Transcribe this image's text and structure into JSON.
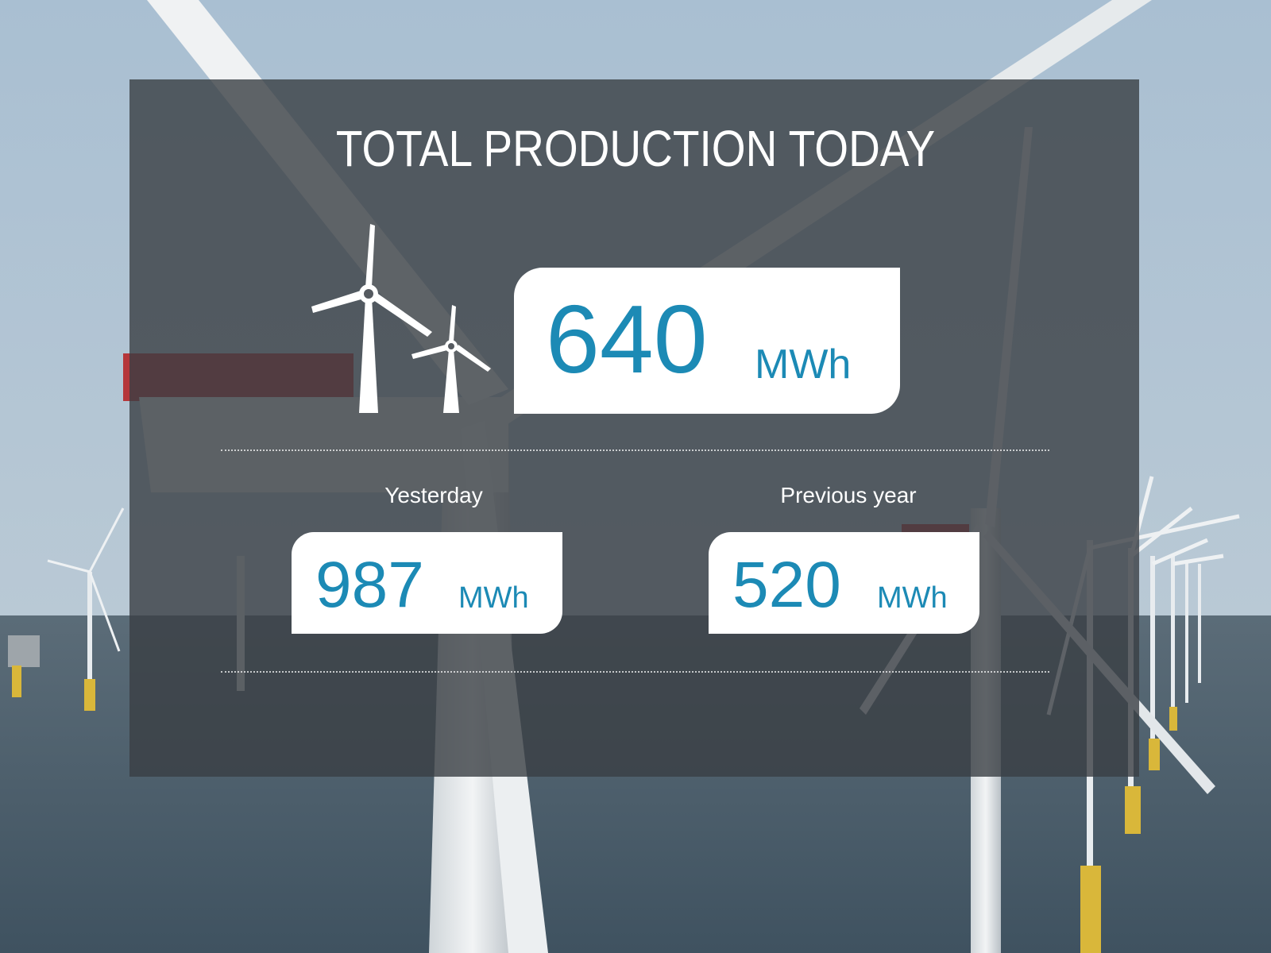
{
  "title": "TOTAL PRODUCTION TODAY",
  "today": {
    "value": "640",
    "unit": "MWh"
  },
  "stats": [
    {
      "label": "Yesterday",
      "value": "987",
      "unit": "MWh"
    },
    {
      "label": "Previous year",
      "value": "520",
      "unit": "MWh"
    }
  ],
  "icons": {
    "production": "wind-turbines-icon"
  },
  "colors": {
    "accent": "#1c8ab5",
    "panel": "#3a3e44",
    "sky": "#9fb6c8",
    "sea": "#4a5b68",
    "turbine_red": "#b5363a",
    "foundation_yellow": "#d9b73a"
  }
}
